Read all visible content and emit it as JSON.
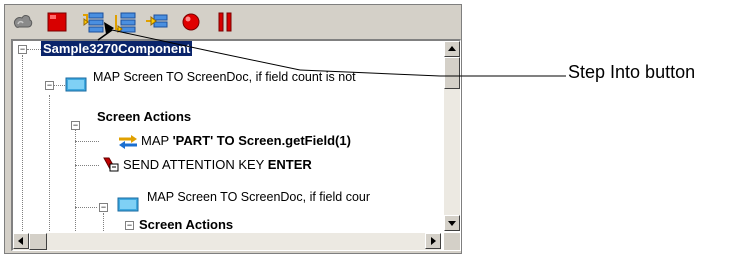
{
  "toolbar": {
    "buttons": [
      {
        "icon": "run-icon"
      },
      {
        "icon": "stop-icon"
      },
      {
        "icon": "step-into-icon"
      },
      {
        "icon": "step-over-icon"
      },
      {
        "icon": "step-return-icon"
      },
      {
        "icon": "breakpoint-icon"
      },
      {
        "icon": "pause-icon"
      }
    ]
  },
  "tree": {
    "root": "Sample3270Component",
    "row1": "MAP Screen TO ScreenDoc, if field count is not",
    "row2": "Screen Actions",
    "row3_prefix": "MAP ",
    "row3_bold": "'PART' TO Screen.getField(1)",
    "row4_prefix": "SEND ATTENTION KEY ",
    "row4_bold": "ENTER",
    "row5": "MAP Screen TO ScreenDoc, if field cour",
    "row6": "Screen Actions"
  },
  "callout": {
    "label": "Step Into button"
  }
}
